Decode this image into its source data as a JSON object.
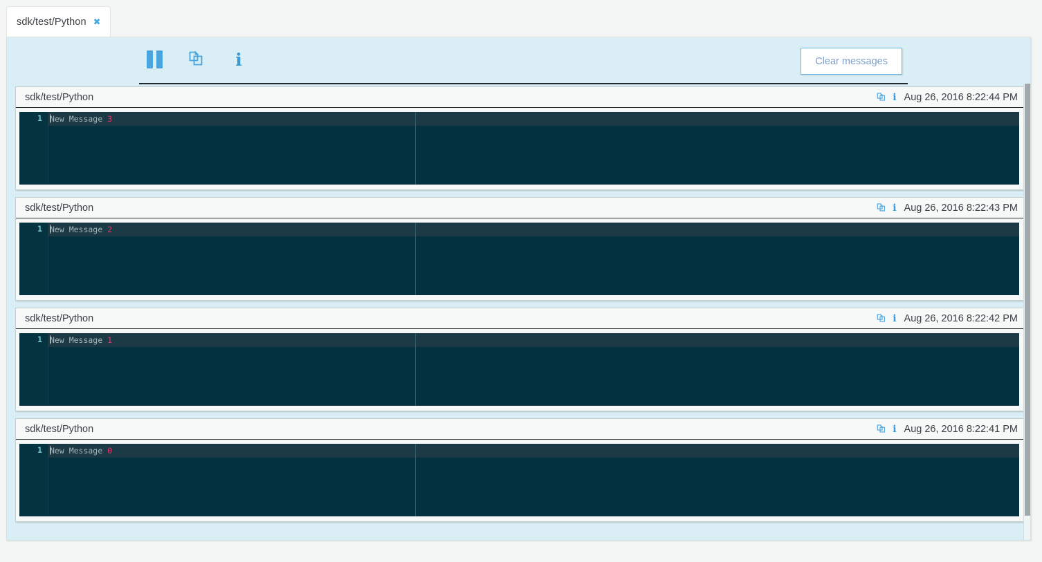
{
  "tab": {
    "label": "sdk/test/Python",
    "close_glyph": "✖"
  },
  "toolbar": {
    "pause_icon": "pause-icon",
    "copy_icon": "copy-icon",
    "info_icon": "info-icon",
    "info_glyph": "i",
    "clear_label": "Clear messages"
  },
  "colors": {
    "accent": "#4ba5dd",
    "panel_bg": "#d9eff5",
    "editor_bg": "#04313f",
    "editor_active_line": "#1b3a46",
    "line_number": "#74c6d8",
    "code_text": "#a9b7b7",
    "code_number": "#e0376e",
    "button_border": "#63b6e4",
    "underline": "#1e2a30"
  },
  "messages": [
    {
      "title": "sdk/test/Python",
      "timestamp": "Aug 26, 2016 8:22:44 PM",
      "line_number": "1",
      "code_text": "New Message ",
      "code_value": "3"
    },
    {
      "title": "sdk/test/Python",
      "timestamp": "Aug 26, 2016 8:22:43 PM",
      "line_number": "1",
      "code_text": "New Message ",
      "code_value": "2"
    },
    {
      "title": "sdk/test/Python",
      "timestamp": "Aug 26, 2016 8:22:42 PM",
      "line_number": "1",
      "code_text": "New Message ",
      "code_value": "1"
    },
    {
      "title": "sdk/test/Python",
      "timestamp": "Aug 26, 2016 8:22:41 PM",
      "line_number": "1",
      "code_text": "New Message ",
      "code_value": "0"
    }
  ]
}
